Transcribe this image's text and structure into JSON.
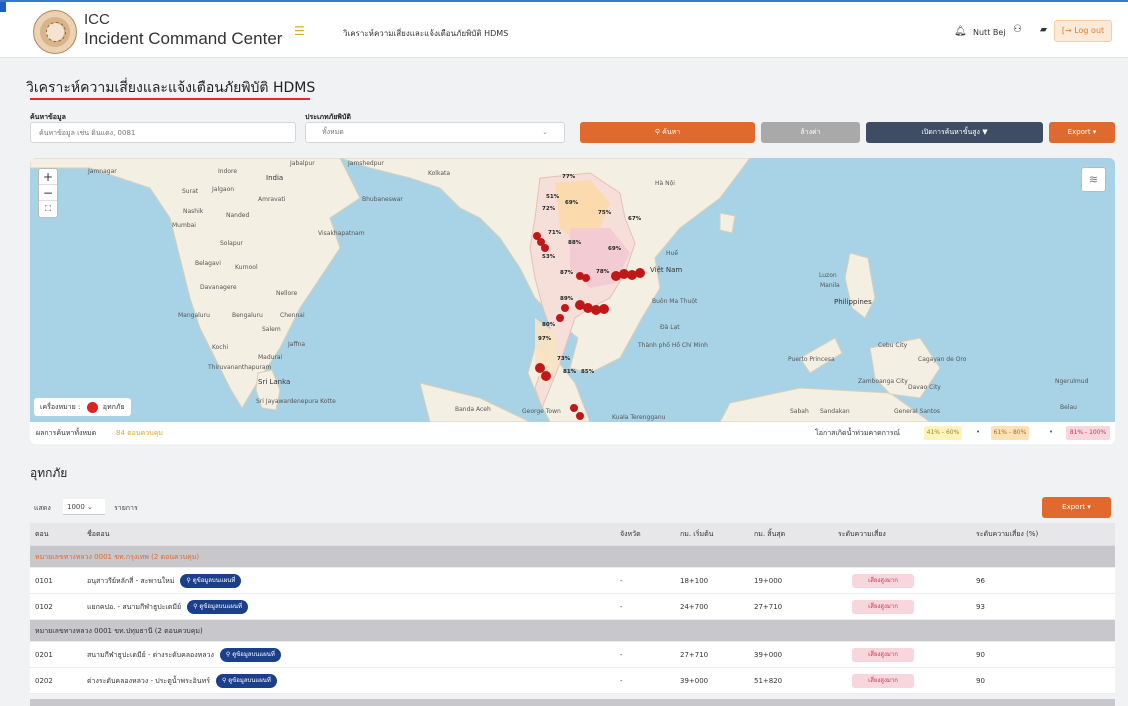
{
  "header": {
    "brand_line1": "ICC",
    "brand_line2": "Incident Command Center",
    "title": "วิเคราะห์ความเสี่ยงและแจ้งเตือนภัยพิบัติ HDMS",
    "username": "Nutt Bej",
    "logout_label": "Log out",
    "icons": [
      "hamburger-icon",
      "bell-icon",
      "user-icon",
      "book-icon",
      "logout-icon"
    ]
  },
  "page": {
    "title": "วิเคราะห์ความเสี่ยงและแจ้งเตือนภัยพิบัติ HDMS"
  },
  "search": {
    "label": "ค้นหาข้อมูล",
    "placeholder": "ค้นหาข้อมูล เช่น ดินแดง, 0081",
    "type_label": "ประเภทภัยพิบัติ",
    "type_value": "ทั้งหมด",
    "search_button": "ค้นหา",
    "clear_button": "ล้างค่า",
    "advanced_button": "เปิดการค้นหาขั้นสูง",
    "export_button": "Export"
  },
  "map": {
    "zoom_in": "+",
    "zoom_out": "−",
    "fullscreen": "⛶",
    "legend_label": "เครื่องหมาย :",
    "legend_item": "อุทกภัย",
    "places": [
      "Jamnagar",
      "Indore",
      "India",
      "Jabalpur",
      "Jamshedpur",
      "Kolkata",
      "Surat",
      "Jalgaon",
      "Amravati",
      "Bhubaneswar",
      "Nashik",
      "Nanded",
      "Mumbai",
      "Visakhapatnam",
      "Solapur",
      "Belagavi",
      "Kurnool",
      "Davanagere",
      "Nellore",
      "Mangaluru",
      "Bengaluru",
      "Chennai",
      "Salem",
      "Kochi",
      "Madurai",
      "Jaffna",
      "Thiruvananthapuram",
      "Sri Lanka",
      "Sri Jayawardenepura Kotte",
      "Banda Aceh",
      "George Town",
      "Kuala Terengganu",
      "Hà Nội",
      "Huế",
      "Việt Nam",
      "Buôn Ma Thuột",
      "Đà Lạt",
      "Thành phố Hồ Chí Minh",
      "Luzon",
      "Manila",
      "Philippines",
      "Puerto Princesa",
      "Cebu City",
      "Cagayan de Oro",
      "Zamboanga City",
      "Davao City",
      "General Santos",
      "Sabah",
      "Sandakan",
      "Ngerulmud",
      "Belau"
    ],
    "percent_labels": [
      "77%",
      "51%",
      "72%",
      "69%",
      "75%",
      "67%",
      "71%",
      "88%",
      "53%",
      "87%",
      "78%",
      "89%",
      "80%",
      "97%",
      "73%",
      "81%",
      "85%",
      "69%"
    ]
  },
  "results": {
    "label": "ผลการค้นหาทั้งหมด",
    "count_text": "84 ตอนควบคุม",
    "probability_label": "โอกาสเกิดน้ำท่วมคาดการณ์",
    "ranges": [
      "41% - 60%",
      "61% - 80%",
      "81% - 100%"
    ],
    "range_colors": [
      "#fff3bd",
      "#fde2b8",
      "#f8d6dd"
    ]
  },
  "section": {
    "title": "อุทกภัย",
    "show_label": "แสดง",
    "page_size": "1000",
    "records_label": "รายการ",
    "export_button": "Export"
  },
  "table": {
    "columns": [
      "ตอน",
      "ชื่อตอน",
      "จังหวัด",
      "กม. เริ่มต้น",
      "กม. สิ้นสุด",
      "ระดับความเสี่ยง",
      "ระดับความเสี่ยง (%)"
    ],
    "map_link_label": "ดูข้อมูลบนแผนที่",
    "groups": [
      {
        "title": "หมายเลขทางหลวง 0001 ขท.กรุงเทพ (2 ตอนควบคุม)",
        "rows": [
          {
            "code": "0101",
            "name": "อนุสาวรีย์หลักสี่ - สะพานใหม่",
            "province": "-",
            "km_start": "18+100",
            "km_end": "19+000",
            "risk": "เสี่ยงสูงมาก",
            "risk_pct": "96"
          },
          {
            "code": "0102",
            "name": "แยกคปอ. - สนามกีฬาธูปะเตมีย์",
            "province": "-",
            "km_start": "24+700",
            "km_end": "27+710",
            "risk": "เสี่ยงสูงมาก",
            "risk_pct": "93"
          }
        ]
      },
      {
        "title": "หมายเลขทางหลวง 0001 ขท.ปทุมธานี (2 ตอนควบคุม)",
        "rows": [
          {
            "code": "0201",
            "name": "สนามกีฬาธูปะเตมีย์ - ต่างระดับคลองหลวง",
            "province": "-",
            "km_start": "27+710",
            "km_end": "39+000",
            "risk": "เสี่ยงสูงมาก",
            "risk_pct": "90"
          },
          {
            "code": "0202",
            "name": "ต่างระดับคลองหลวง - ประตูน้ำพระอินทร์",
            "province": "-",
            "km_start": "39+000",
            "km_end": "51+820",
            "risk": "เสี่ยงสูงมาก",
            "risk_pct": "90"
          }
        ]
      }
    ]
  }
}
